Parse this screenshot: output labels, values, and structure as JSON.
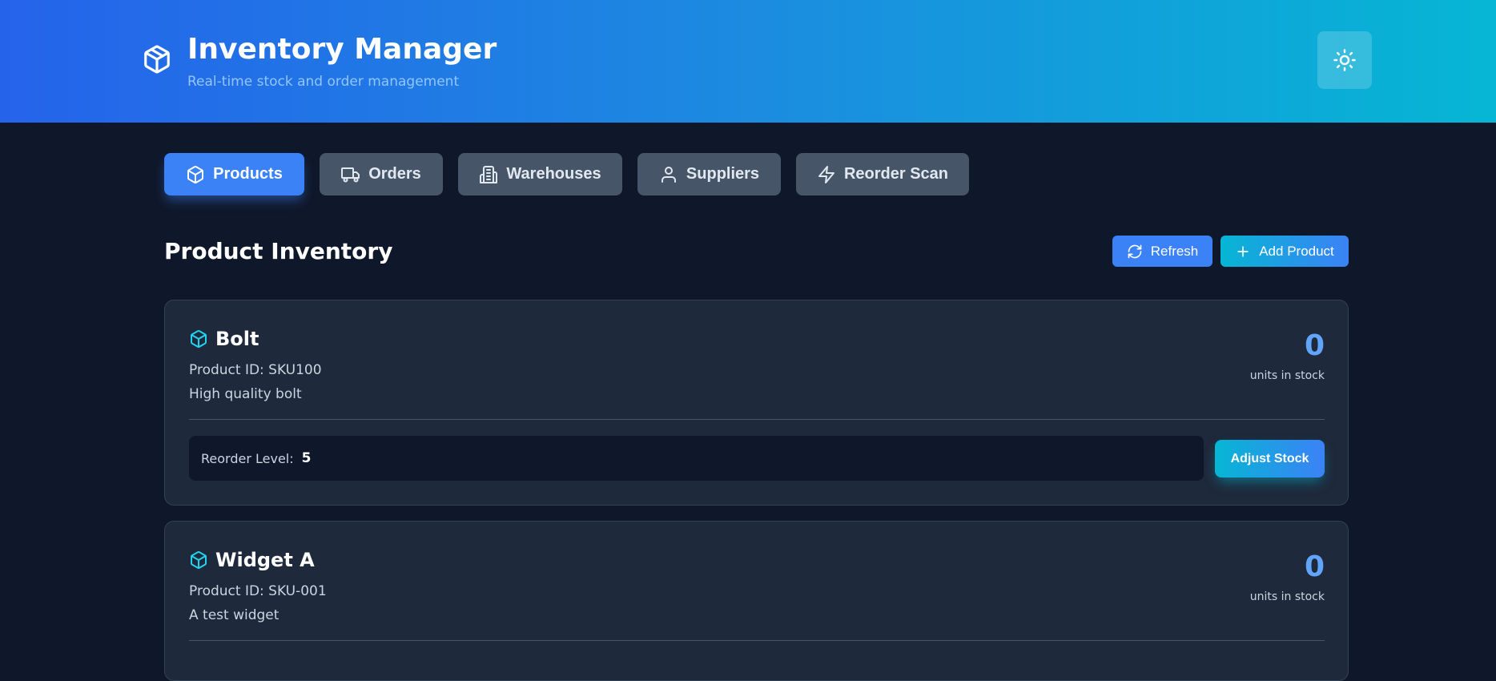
{
  "header": {
    "title": "Inventory Manager",
    "subtitle": "Real-time stock and order management",
    "logo_icon": "package-icon",
    "theme_toggle_icon": "sun-icon"
  },
  "tabs": [
    {
      "label": "Products",
      "icon": "package-icon",
      "active": true
    },
    {
      "label": "Orders",
      "icon": "truck-icon",
      "active": false
    },
    {
      "label": "Warehouses",
      "icon": "building-icon",
      "active": false
    },
    {
      "label": "Suppliers",
      "icon": "user-icon",
      "active": false
    },
    {
      "label": "Reorder Scan",
      "icon": "zap-icon",
      "active": false
    }
  ],
  "section": {
    "title": "Product Inventory",
    "refresh_label": "Refresh",
    "add_label": "Add Product"
  },
  "products": [
    {
      "name": "Bolt",
      "id_text": "Product ID: SKU100",
      "description": "High quality bolt",
      "stock": "0",
      "stock_label": "units in stock",
      "reorder_label": "Reorder Level:",
      "reorder_value": "5",
      "adjust_label": "Adjust Stock"
    },
    {
      "name": "Widget A",
      "id_text": "Product ID: SKU-001",
      "description": "A test widget",
      "stock": "0",
      "stock_label": "units in stock"
    }
  ],
  "colors": {
    "background": "#0f172a",
    "card": "#1e293b",
    "accent_blue": "#3b82f6",
    "accent_cyan": "#06b6d4",
    "tab_inactive": "#475569"
  }
}
